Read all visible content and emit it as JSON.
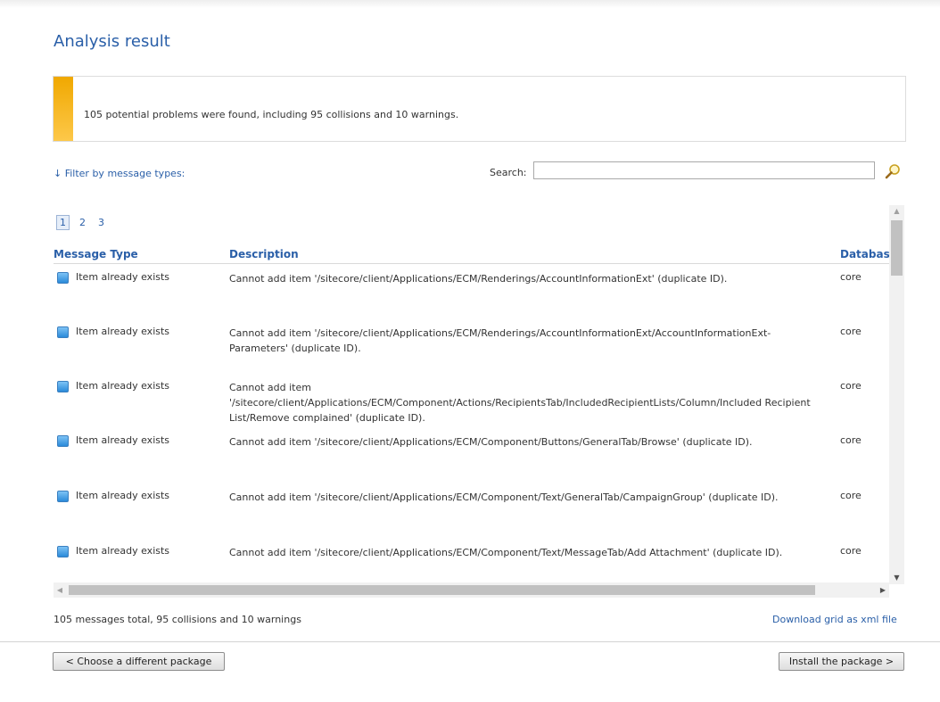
{
  "page": {
    "title": "Analysis result",
    "banner_message": "105 potential problems were found, including 95 collisions and 10 warnings."
  },
  "toolbar": {
    "filter_label": "↓ Filter by message types:",
    "search_label": "Search:",
    "search_value": "",
    "search_icon": "magnifier-icon"
  },
  "pager": {
    "pages": [
      "1",
      "2",
      "3"
    ],
    "active": "1"
  },
  "grid": {
    "columns": [
      "Message Type",
      "Description",
      "Database"
    ],
    "rows": [
      {
        "type": "Item already exists",
        "description": "Cannot add item '/sitecore/client/Applications/ECM/Renderings/AccountInformationExt' (duplicate ID).",
        "database": "core"
      },
      {
        "type": "Item already exists",
        "description": "Cannot add item '/sitecore/client/Applications/ECM/Renderings/AccountInformationExt/AccountInformationExt-Parameters' (duplicate ID).",
        "database": "core"
      },
      {
        "type": "Item already exists",
        "description": "Cannot add item '/sitecore/client/Applications/ECM/Component/Actions/RecipientsTab/IncludedRecipientLists/Column/Included Recipient List/Remove complained' (duplicate ID).",
        "database": "core"
      },
      {
        "type": "Item already exists",
        "description": "Cannot add item '/sitecore/client/Applications/ECM/Component/Buttons/GeneralTab/Browse' (duplicate ID).",
        "database": "core"
      },
      {
        "type": "Item already exists",
        "description": "Cannot add item '/sitecore/client/Applications/ECM/Component/Text/GeneralTab/CampaignGroup' (duplicate ID).",
        "database": "core"
      },
      {
        "type": "Item already exists",
        "description": "Cannot add item '/sitecore/client/Applications/ECM/Component/Text/MessageTab/Add Attachment' (duplicate ID).",
        "database": "core"
      }
    ]
  },
  "footer": {
    "count_text": "105 messages total, 95 collisions and 10 warnings",
    "download_link": "Download grid as xml file"
  },
  "buttons": {
    "back": "< Choose a different package",
    "install": "Install the package >"
  },
  "colors": {
    "accent": "#2a5fa8",
    "warning_stripe": "#f0a800"
  }
}
